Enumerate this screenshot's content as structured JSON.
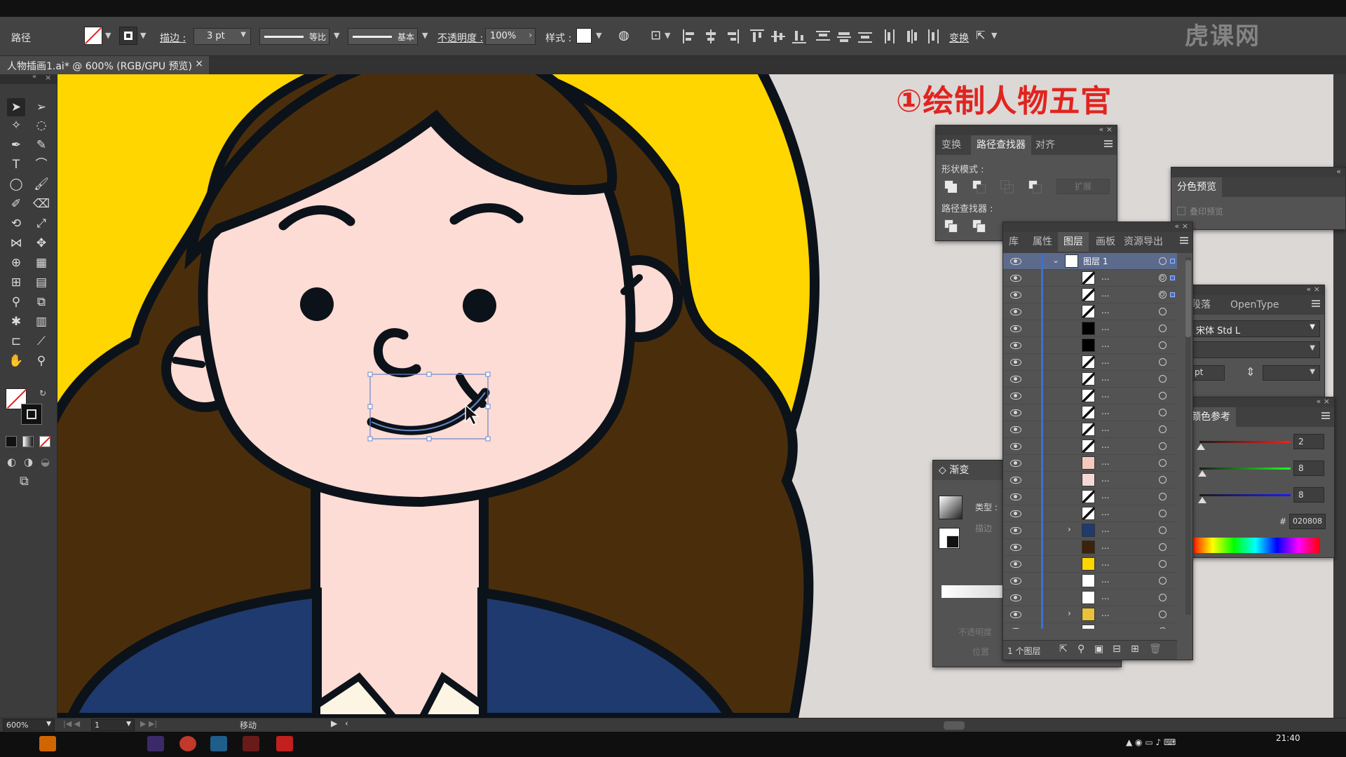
{
  "app": {
    "watermark": "虎课网",
    "menu_placeholders": 8
  },
  "control_bar": {
    "selection_type": "路径",
    "stroke_label": "描边 :",
    "stroke_weight": "3 pt",
    "profile_label": "等比",
    "brush_label": "基本",
    "opacity_label": "不透明度 :",
    "opacity_value": "100%",
    "style_label": "样式 :",
    "transform_label": "变换"
  },
  "document": {
    "tab_title": "人物插画1.ai* @ 600% (RGB/GPU 预览)",
    "close_glyph": "×"
  },
  "canvas": {
    "annotation": "①绘制人物五官",
    "colors": {
      "background": "#dcd8d6",
      "halo": "#ffd600",
      "hair": "#4a2e0c",
      "skin": "#fddcd5",
      "outline": "#0c1219",
      "jacket": "#1f3a6f",
      "shirt": "#fdf5e4"
    }
  },
  "pathfinder_panel": {
    "tabs": [
      "变换",
      "路径查找器",
      "对齐"
    ],
    "active_tab": "路径查找器",
    "shape_modes_label": "形状模式 :",
    "expand_label": "扩展",
    "pathfinders_label": "路径查找器 :"
  },
  "separations_panel": {
    "tab": "分色预览",
    "overprint_label": "叠印预览"
  },
  "layers_panel": {
    "tabs": [
      "库",
      "属性",
      "图层",
      "画板",
      "资源导出"
    ],
    "active_tab": "图层",
    "layer_name": "图层 1",
    "item_label": "...",
    "footer_count": "1 个图层",
    "thumbnails": [
      "path-diag",
      "path-curve",
      "path-c",
      "ellipse",
      "ellipse",
      "path-arc",
      "path-arc",
      "path-stripe",
      "path-diag",
      "path-x",
      "path-x",
      "skin",
      "skin-rect",
      "path-c",
      "path-c",
      "group-eye",
      "hair",
      "halo",
      "blank",
      "blank",
      "group-yellow",
      "star"
    ]
  },
  "character_panel": {
    "tabs": [
      "段落",
      "OpenType"
    ],
    "font_family": "宋体 Std L",
    "size_unit": "pt"
  },
  "gradient_panel": {
    "title": "渐变",
    "type_label": "类型 :",
    "stroke_label": "描边",
    "opacity_label": "不透明度",
    "location_label": "位置"
  },
  "color_panel": {
    "title": "颜色参考",
    "values": {
      "r": "2",
      "g": "8",
      "b": "8"
    },
    "hex": "020808",
    "hex_prefix": "#"
  },
  "status_bar": {
    "zoom": "600%",
    "artboard": "1",
    "tool_status": "移动"
  },
  "taskbar": {
    "time": "21:40"
  }
}
